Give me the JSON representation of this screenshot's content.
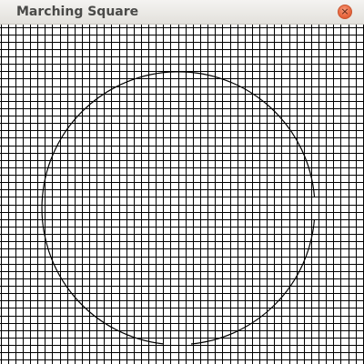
{
  "window": {
    "title": "Marching Square",
    "close_icon": "close-icon",
    "close_glyph": "×",
    "accent_close": "#e8633a"
  },
  "canvas": {
    "background": "#ffffff",
    "grid_color": "#000000",
    "contour_color": "#000000",
    "shape": "circle-contour"
  }
}
